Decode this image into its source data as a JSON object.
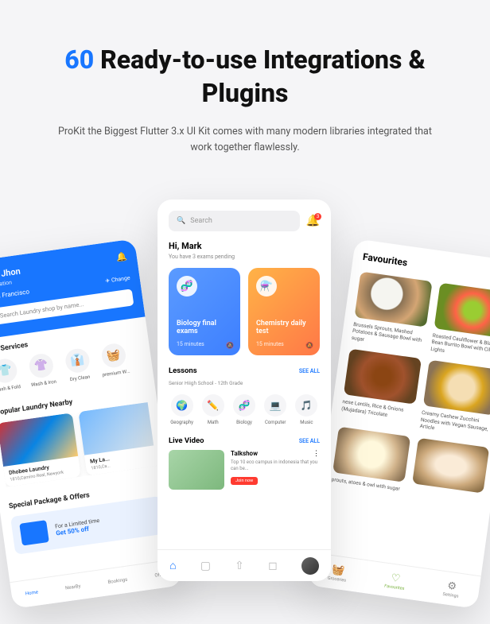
{
  "hero": {
    "accent": "60",
    "title_rest": " Ready-to-use Integrations & Plugins",
    "subtitle": "ProKit the Biggest Flutter 3.x UI Kit comes with many modern libraries integrated that work together flawlessly."
  },
  "laundry": {
    "hello": "Hello, Jhon",
    "location_label": "Your Location",
    "city": "San Francisco",
    "change": "✈ Change",
    "search_placeholder": "Search Laundry shop by name...",
    "top_services_title": "Top Services",
    "services": [
      {
        "label": "Wash & Fold"
      },
      {
        "label": "Wash & Iron"
      },
      {
        "label": "Dry Clean"
      },
      {
        "label": "premium W..."
      }
    ],
    "nearby_title": "Popular Laundry Nearby",
    "nearby": [
      {
        "title": "Dhobee Laundry",
        "sub": "1810,Camino Real, Newyork"
      },
      {
        "title": "My La...",
        "sub": "1810,Ca..."
      }
    ],
    "offers_title": "Special Package & Offers",
    "offer_line1": "For a Limited time",
    "offer_line2": "Get 50% off",
    "tabs": [
      "Home",
      "NearBy",
      "Bookings",
      "Offe..."
    ]
  },
  "edu": {
    "search_placeholder": "Search",
    "notification_count": "3",
    "greeting": "Hi, Mark",
    "pending": "You have 3 exams pending",
    "cards": [
      {
        "title": "Biology final exams",
        "time": "15 minutes"
      },
      {
        "title": "Chemistry daily test",
        "time": "15 minutes"
      }
    ],
    "lessons_title": "Lessons",
    "grade": "Senior Hiigh School - 12th Grade",
    "see_all": "SEE ALL",
    "subjects": [
      {
        "label": "Geography"
      },
      {
        "label": "Math"
      },
      {
        "label": "Biology"
      },
      {
        "label": "Computer"
      },
      {
        "label": "Music"
      }
    ],
    "video_title": "Live Video",
    "video": {
      "title": "Talkshow",
      "desc": "Top 10 eco campus in indonesia that you can be...",
      "btn": "Join now"
    }
  },
  "food": {
    "title": "Favourites",
    "items": [
      {
        "label": "Brussels Sprouts, Mashed Potatoes & Sausage Bowl with sugar"
      },
      {
        "label": "Roasted Cauliflower & Black Bean Burrito Bowl with Cilantro Lights"
      },
      {
        "label": "nese Lentils, Rice & Onions (Mujadara) Tricolate"
      },
      {
        "label": "Creamy Cashew Zucchini Noodles with Vegan Sausage, Article"
      },
      {
        "label": "prouts, atoes & owl with sugar"
      },
      {
        "label": ""
      }
    ],
    "nav": [
      {
        "label": "Groceries"
      },
      {
        "label": "Favourites"
      },
      {
        "label": "Settings"
      }
    ]
  }
}
